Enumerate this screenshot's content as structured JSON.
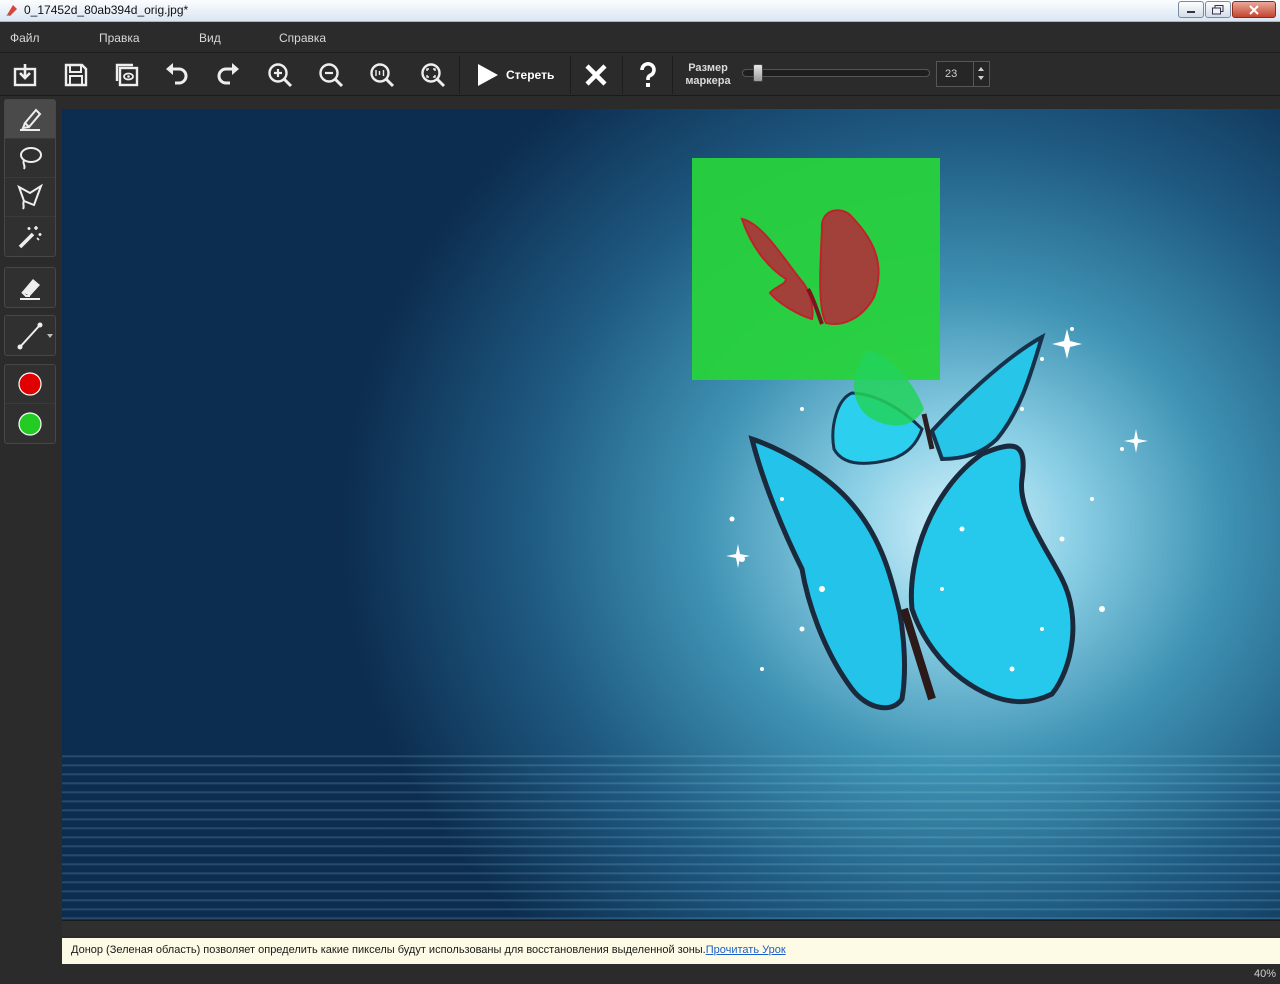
{
  "window": {
    "title": "0_17452d_80ab394d_orig.jpg*"
  },
  "menu": {
    "items": [
      "Файл",
      "Правка",
      "Вид",
      "Справка"
    ]
  },
  "toolbar": {
    "buttons": [
      "open-icon",
      "save-icon",
      "save-as-icon",
      "undo-icon",
      "redo-icon",
      "zoom-in-icon",
      "zoom-out-icon",
      "zoom-1to1-icon",
      "fit-to-window-icon"
    ],
    "run_label": "Стереть",
    "brush_size_label": "Размер маркера",
    "brush_size_value": "23",
    "brush_size_slider_fraction": 0.05
  },
  "tools": [
    "marker-icon",
    "lasso-icon",
    "polygon-lasso-icon",
    "magic-wand-icon",
    "eraser-icon",
    "line-icon",
    "red-color-icon",
    "green-color-icon"
  ],
  "colors": {
    "red_marker": "#e00000",
    "green_donor": "#22cc22",
    "hint_background": "#fdfbe6",
    "link": "#1b5fc9"
  },
  "hint": {
    "text": "Донор (Зеленая область) позволяет определить какие пикселы будут использованы для восстановления выделенной зоны.",
    "link": "Прочитать Урок"
  },
  "status": {
    "zoom": "40%"
  }
}
